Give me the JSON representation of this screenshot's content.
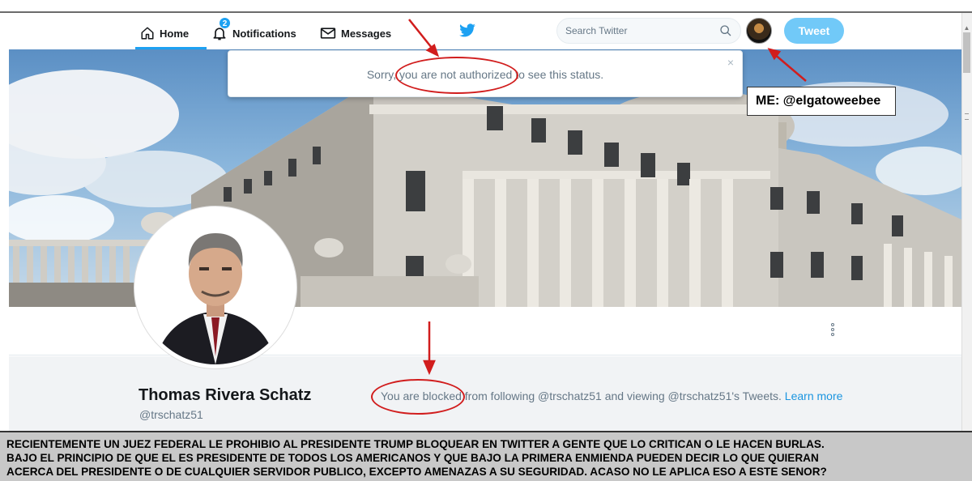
{
  "nav": {
    "home_label": "Home",
    "notifications_label": "Notifications",
    "notifications_badge": "2",
    "messages_label": "Messages",
    "search_placeholder": "Search Twitter",
    "tweet_button": "Tweet"
  },
  "popover": {
    "message": "Sorry, you are not authorized to see this status.",
    "close": "×"
  },
  "annotation": {
    "me_label": "ME: @elgatoweebee"
  },
  "profile": {
    "name": "Thomas Rivera Schatz",
    "handle": "@trschatz51",
    "blocked_text": "You are blocked from following @trschatz51 and viewing @trschatz51's Tweets.",
    "learn_more": "Learn more"
  },
  "caption": {
    "line1": "RECIENTEMENTE UN JUEZ FEDERAL LE PROHIBIO AL PRESIDENTE TRUMP BLOQUEAR EN TWITTER A GENTE QUE LO CRITICAN O LE HACEN BURLAS.",
    "line2": "BAJO EL PRINCIPIO DE QUE EL ES PRESIDENTE DE TODOS LOS AMERICANOS Y QUE BAJO LA PRIMERA ENMIENDA PUEDEN DECIR LO QUE QUIERAN",
    "line3": "ACERCA DEL PRESIDENTE O DE CUALQUIER SERVIDOR PUBLICO, EXCEPTO AMENAZAS A SU SEGURIDAD. ACASO NO LE APLICA ESO A ESTE SENOR?"
  },
  "colors": {
    "twitter_blue": "#1da1f2",
    "tweet_button": "#71c9f8",
    "annotation_red": "#d11d1d"
  },
  "icons": [
    "home-icon",
    "bell-icon",
    "envelope-icon",
    "twitter-bird-icon",
    "search-icon",
    "more-vertical-icon"
  ]
}
